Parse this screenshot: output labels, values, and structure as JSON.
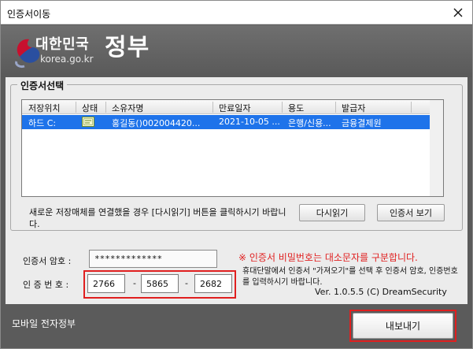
{
  "window": {
    "title": "인증서이동"
  },
  "banner": {
    "logo_main": "대한민국",
    "logo_big": "정부",
    "logo_domain": "korea.go.kr"
  },
  "cert_select": {
    "title": "인증서선택",
    "columns": [
      "저장위치",
      "상태",
      "소유자명",
      "만료일자",
      "용도",
      "발급자"
    ],
    "rows": [
      {
        "location": "하드 C:",
        "status_icon": "certificate-icon",
        "owner": "홍길동()002004420...",
        "expiry": "2021-10-05 ...",
        "usage": "은행/신용...",
        "issuer": "금융결제원"
      }
    ],
    "note": "새로운 저장매체를 연결했을 경우 [다시읽기] 버튼을 클릭하시기 바랍니다.",
    "reload_label": "다시읽기",
    "view_label": "인증서 보기"
  },
  "form": {
    "password_label": "인증서 암호 :",
    "password_value": "*************",
    "auth_label": "인 증  번 호 :",
    "auth_codes": [
      "2766",
      "5865",
      "2682"
    ],
    "dash": "-"
  },
  "warning": "※ 인증서 비밀번호는 대소문자를 구분합니다.",
  "guide": "휴대단말에서 인증서 \"가져오기\"를 선택 후 인증서 암호, 인증번호를 입력하시기 바랍니다.",
  "version": "Ver. 1.0.5.5  (C) DreamSecurity",
  "footer": {
    "mobile_label": "모바일 전자정부",
    "export_label": "내보내기"
  },
  "colors": {
    "selection": "#1e73ea",
    "highlight": "#e01f1f",
    "banner": "#5b5b5b"
  }
}
